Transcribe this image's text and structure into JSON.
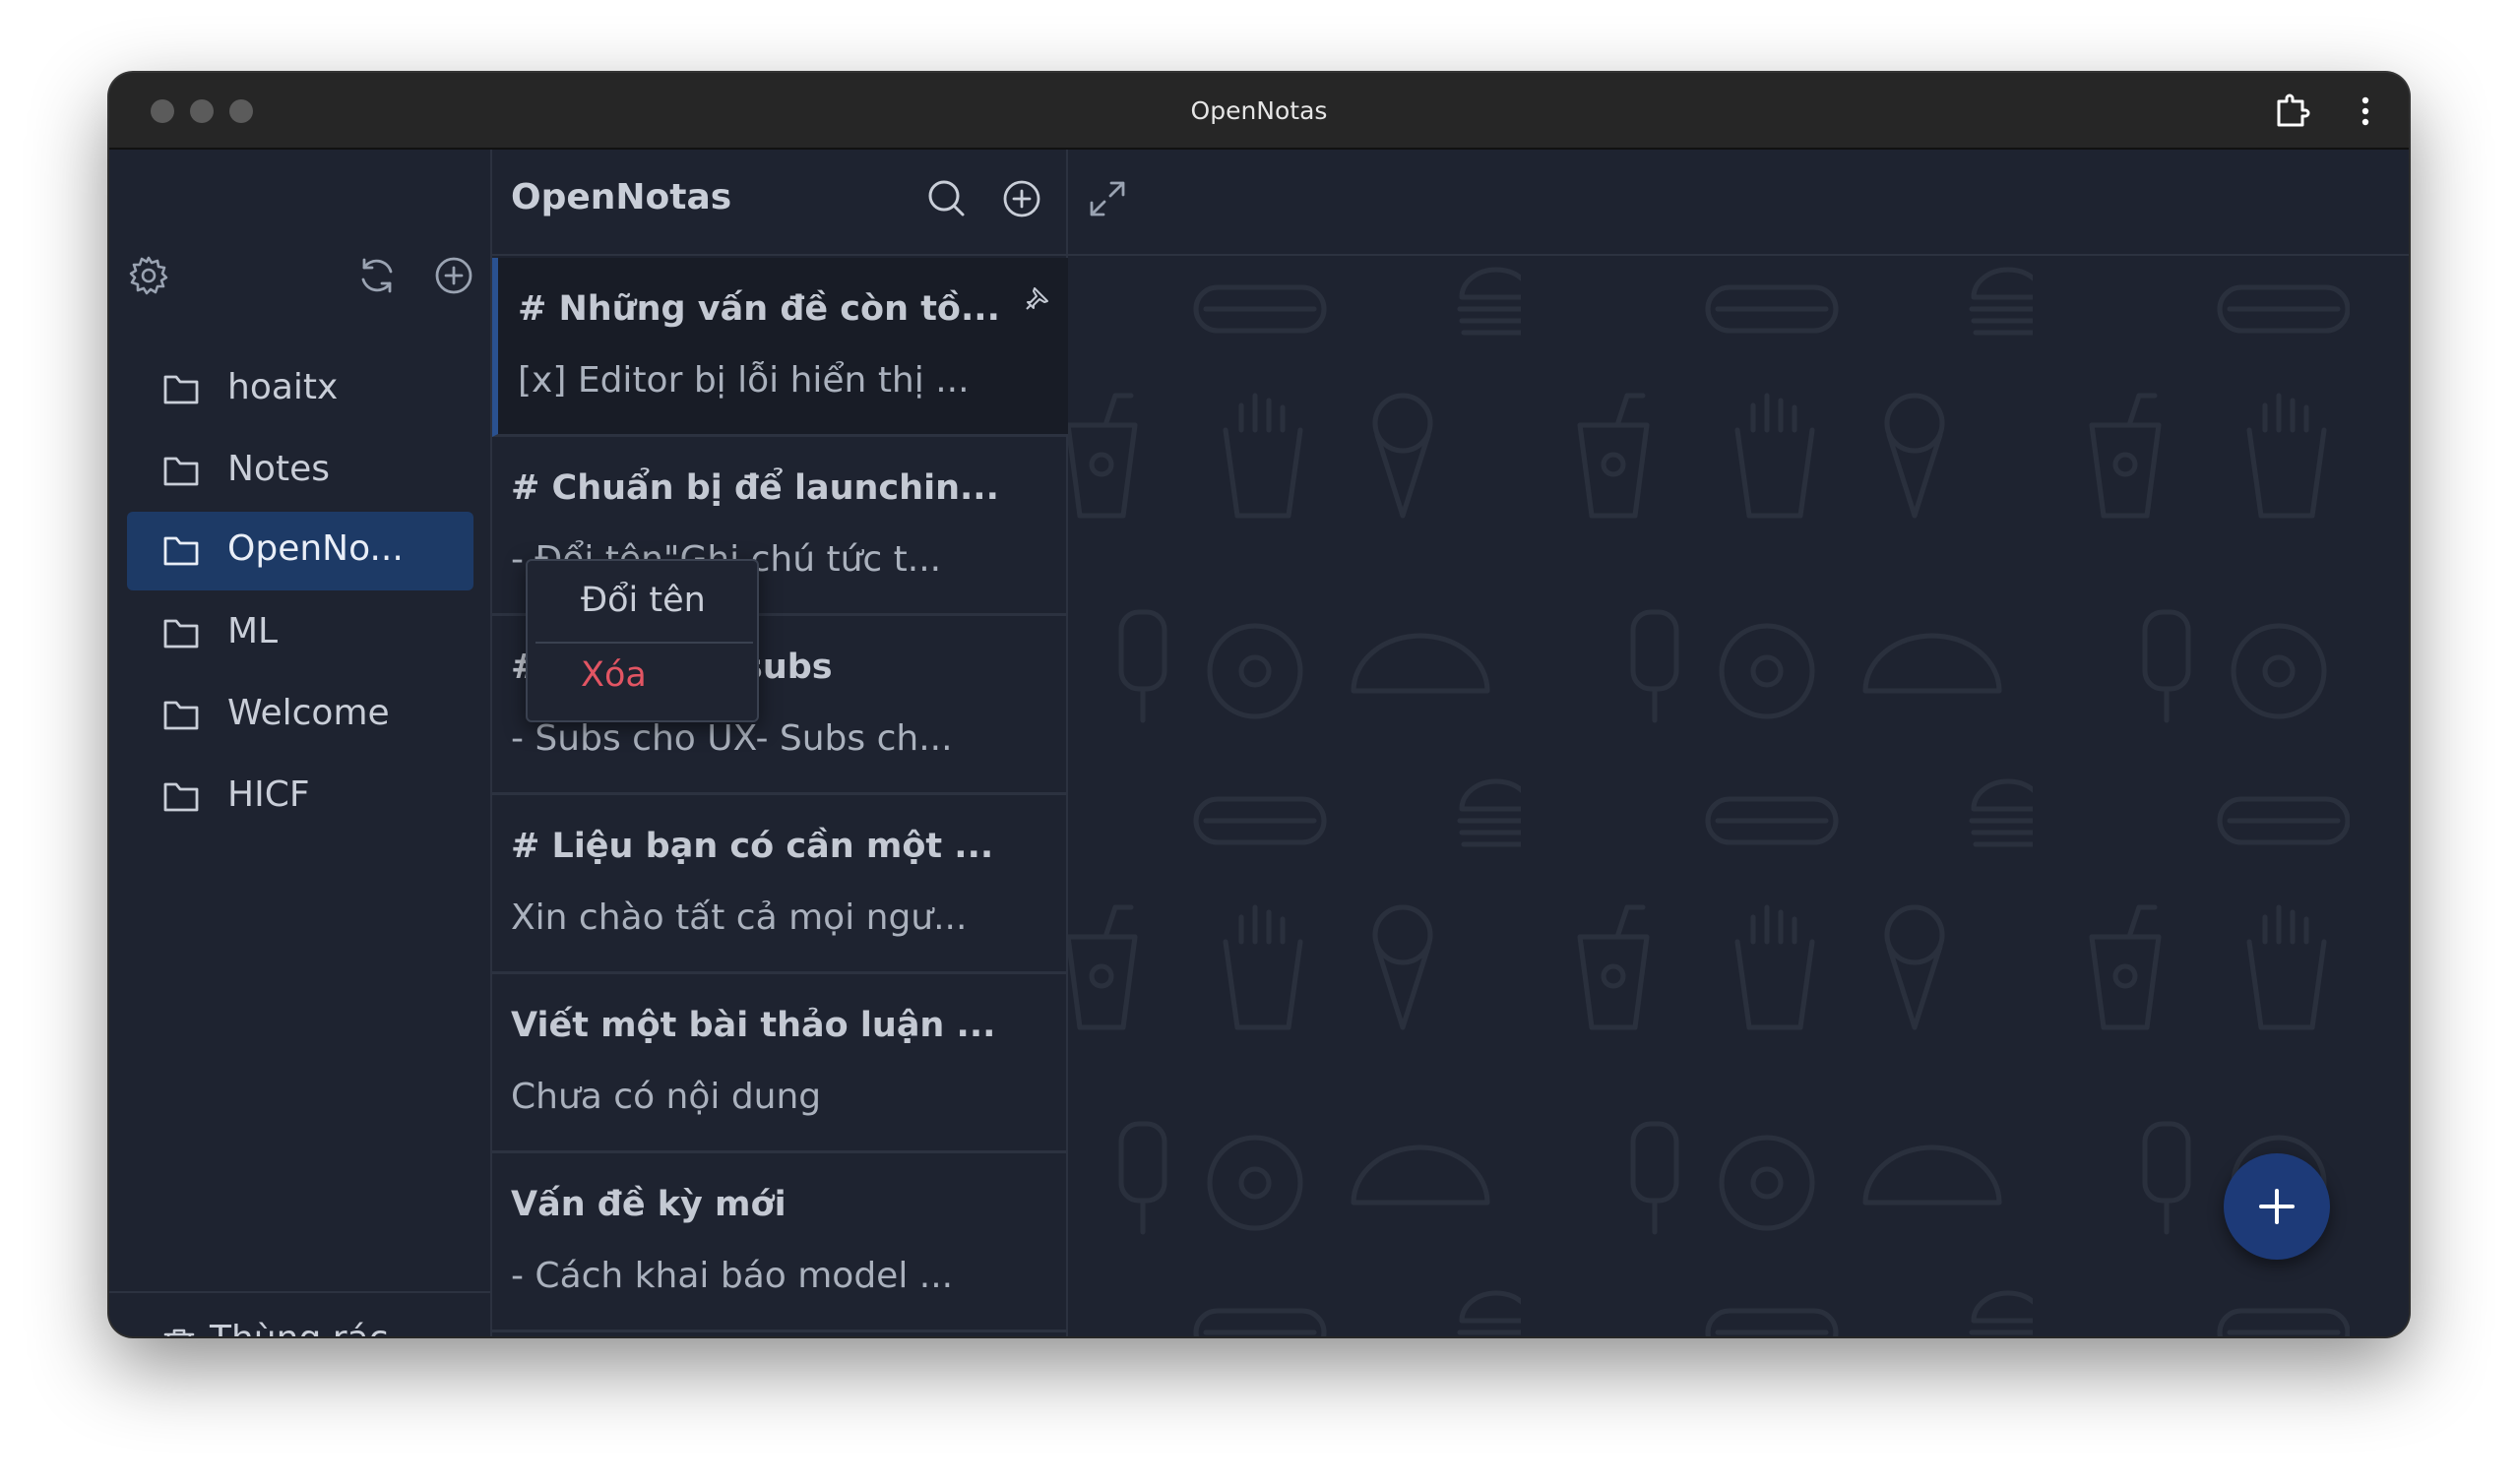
{
  "window": {
    "title": "OpenNotas"
  },
  "sidebar": {
    "folders": [
      {
        "label": "hoaitx",
        "icon": "folder-icon"
      },
      {
        "label": "Notes",
        "icon": "folder-icon"
      },
      {
        "label": "OpenNo...",
        "icon": "folder-icon",
        "active": true
      },
      {
        "label": "ML",
        "icon": "folder-icon"
      },
      {
        "label": "Welcome",
        "icon": "folder-icon"
      },
      {
        "label": "HICF",
        "icon": "folder-icon"
      }
    ],
    "trash_label": "Thùng rác"
  },
  "notes_panel": {
    "title": "OpenNotas",
    "notes": [
      {
        "title": "# Những vấn đề còn tồ...",
        "preview": "[x] Editor bị lỗi hiển thị ...",
        "pinned": true
      },
      {
        "title": "# Chuẩn bị để launchin...",
        "preview": "- Đổi tên\"Ghi chú tức t..."
      },
      {
        "title": "# Kế hoạch subs",
        "preview": "- Subs cho UX- Subs ch..."
      },
      {
        "title": "# Liệu bạn có cần một ...",
        "preview": "Xin chào tất cả mọi ngư..."
      },
      {
        "title": "Viết một bài thảo luận ...",
        "preview": "Chưa có nội dung"
      },
      {
        "title": "Vấn đề kỳ mới",
        "preview": "- Cách khai báo model ..."
      }
    ]
  },
  "context_menu": {
    "rename_label": "Đổi tên",
    "delete_label": "Xóa"
  },
  "colors": {
    "accent": "#1d3a66",
    "fab": "#1d3a78",
    "danger": "#e25563",
    "background": "#1e2330"
  }
}
